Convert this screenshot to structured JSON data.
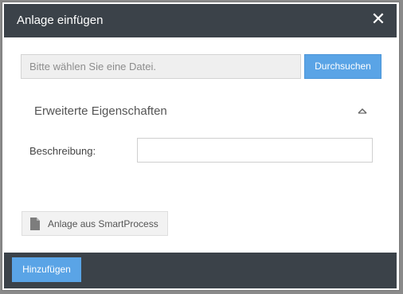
{
  "dialog": {
    "title": "Anlage einfügen",
    "close_glyph": "✕",
    "close_icon": "close-icon"
  },
  "file": {
    "placeholder": "Bitte wählen Sie eine Datei.",
    "browse_label": "Durchsuchen"
  },
  "advanced": {
    "title": "Erweiterte Eigenschaften",
    "toggle_icon": "chevron-up-icon",
    "description_label": "Beschreibung:",
    "description_value": ""
  },
  "smartprocess": {
    "label": "Anlage aus SmartProcess",
    "icon": "document-icon"
  },
  "footer": {
    "add_label": "Hinzufügen"
  },
  "colors": {
    "titlebar": "#3b4249",
    "accent": "#5aa4e6"
  }
}
